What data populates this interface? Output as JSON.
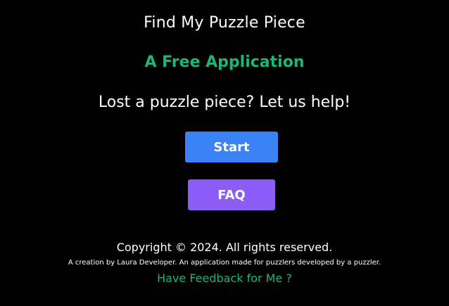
{
  "header": {
    "title": "Find My Puzzle Piece",
    "subtitle": "A Free Application",
    "tagline": "Lost a puzzle piece? Let us help!"
  },
  "actions": {
    "start_label": "Start",
    "faq_label": "FAQ"
  },
  "footer": {
    "copyright": "Copyright © 2024. All rights reserved.",
    "credit": "A creation by Laura Developer. An application made for puzzlers developed by a puzzler.",
    "feedback_link": "Have Feedback for Me ?"
  },
  "colors": {
    "background": "#000000",
    "accent_green": "#1db57a",
    "start_button": "#3b82f6",
    "faq_button": "#8b5cf6",
    "text": "#ffffff"
  }
}
